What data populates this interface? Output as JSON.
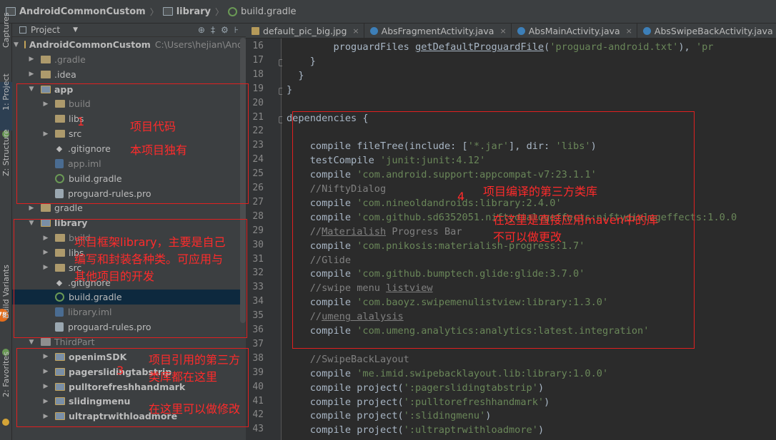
{
  "breadcrumb": [
    "AndroidCommonCustom",
    "library",
    "build.gradle"
  ],
  "tool_stripe": [
    "Captures",
    "1: Project",
    "Z: Structure",
    "Build Variants",
    "2: Favorites"
  ],
  "badge_text": "78",
  "project_panel": {
    "title": "Project",
    "tools": [
      "⊕",
      "‡",
      "⚙",
      "⊦"
    ],
    "rows": [
      {
        "indent": 0,
        "twisty": "▼",
        "icon": "module",
        "name": "AndroidCommonCustom",
        "path": "C:\\Users\\hejian\\Andr",
        "style": "bold"
      },
      {
        "indent": 1,
        "twisty": "▶",
        "icon": "folder",
        "name": ".gradle",
        "style": "dim"
      },
      {
        "indent": 1,
        "twisty": "▶",
        "icon": "folder",
        "name": ".idea",
        "style": ""
      },
      {
        "indent": 1,
        "twisty": "▼",
        "icon": "module",
        "name": "app",
        "style": "bold"
      },
      {
        "indent": 2,
        "twisty": "▶",
        "icon": "folder",
        "name": "build",
        "style": "dim"
      },
      {
        "indent": 2,
        "twisty": "",
        "icon": "folder",
        "name": "libs",
        "style": ""
      },
      {
        "indent": 2,
        "twisty": "▶",
        "icon": "folder",
        "name": "src",
        "style": ""
      },
      {
        "indent": 2,
        "twisty": "",
        "icon": "git",
        "name": ".gitignore",
        "style": ""
      },
      {
        "indent": 2,
        "twisty": "",
        "icon": "iml",
        "name": "app.iml",
        "style": "dim"
      },
      {
        "indent": 2,
        "twisty": "",
        "icon": "gradle",
        "name": "build.gradle",
        "style": ""
      },
      {
        "indent": 2,
        "twisty": "",
        "icon": "pro",
        "name": "proguard-rules.pro",
        "style": ""
      },
      {
        "indent": 1,
        "twisty": "▶",
        "icon": "folder",
        "name": "gradle",
        "style": ""
      },
      {
        "indent": 1,
        "twisty": "▼",
        "icon": "module",
        "name": "library",
        "style": "bold"
      },
      {
        "indent": 2,
        "twisty": "▶",
        "icon": "folder",
        "name": "build",
        "style": "dim"
      },
      {
        "indent": 2,
        "twisty": "▶",
        "icon": "folder",
        "name": "libs",
        "style": ""
      },
      {
        "indent": 2,
        "twisty": "▶",
        "icon": "folder",
        "name": "src",
        "style": ""
      },
      {
        "indent": 2,
        "twisty": "",
        "icon": "git",
        "name": ".gitignore",
        "style": ""
      },
      {
        "indent": 2,
        "twisty": "",
        "icon": "gradle",
        "name": "build.gradle",
        "style": "",
        "selected": true
      },
      {
        "indent": 2,
        "twisty": "",
        "icon": "iml",
        "name": "library.iml",
        "style": "dim"
      },
      {
        "indent": 2,
        "twisty": "",
        "icon": "pro",
        "name": "proguard-rules.pro",
        "style": ""
      },
      {
        "indent": 1,
        "twisty": "▼",
        "icon": "folder-gray",
        "name": "ThirdPart",
        "style": "dim"
      },
      {
        "indent": 2,
        "twisty": "▶",
        "icon": "module",
        "name": "openimSDK",
        "style": "bold"
      },
      {
        "indent": 2,
        "twisty": "▶",
        "icon": "module",
        "name": "pagerslidingtabstrip",
        "style": "bold"
      },
      {
        "indent": 2,
        "twisty": "▶",
        "icon": "module",
        "name": "pulltorefreshhandmark",
        "style": "bold"
      },
      {
        "indent": 2,
        "twisty": "▶",
        "icon": "module",
        "name": "slidingmenu",
        "style": "bold"
      },
      {
        "indent": 2,
        "twisty": "▶",
        "icon": "module",
        "name": "ultraptrwithloadmore",
        "style": "bold"
      }
    ]
  },
  "tabs": [
    {
      "label": "default_pic_big.jpg",
      "kind": "img"
    },
    {
      "label": "AbsFragmentActivity.java",
      "kind": "java"
    },
    {
      "label": "AbsMainActivity.java",
      "kind": "java"
    },
    {
      "label": "AbsSwipeBackActivity.java",
      "kind": "java"
    }
  ],
  "line_numbers": [
    "16",
    "17",
    "18",
    "19",
    "20",
    "21",
    "22",
    "23",
    "24",
    "25",
    "26",
    "27",
    "28",
    "29",
    "30",
    "31",
    "32",
    "33",
    "34",
    "35",
    "36",
    "37",
    "38",
    "39",
    "40",
    "41",
    "42",
    "43"
  ],
  "code_lines": [
    [
      [
        "        proguardFiles ",
        "kw"
      ],
      [
        "getDefaultProguardFile",
        "und"
      ],
      [
        "(",
        "kw"
      ],
      [
        "'proguard-android.txt'",
        "str"
      ],
      [
        "), ",
        "kw"
      ],
      [
        "'pr",
        "str"
      ]
    ],
    [
      [
        "    }",
        "kw"
      ]
    ],
    [
      [
        "  }",
        "kw"
      ]
    ],
    [
      [
        "}",
        "kw"
      ]
    ],
    [
      [
        "",
        "kw"
      ]
    ],
    [
      [
        "dependencies {",
        "kw"
      ]
    ],
    [
      [
        "",
        "kw"
      ]
    ],
    [
      [
        "    compile fileTree(include: [",
        "kw"
      ],
      [
        "'*.jar'",
        "str"
      ],
      [
        "], dir: ",
        "kw"
      ],
      [
        "'libs'",
        "str"
      ],
      [
        ")",
        "kw"
      ]
    ],
    [
      [
        "    testCompile ",
        "kw"
      ],
      [
        "'junit:junit:4.12'",
        "str"
      ]
    ],
    [
      [
        "    compile ",
        "kw"
      ],
      [
        "'com.android.support:appcompat-v7:23.1.1'",
        "str"
      ]
    ],
    [
      [
        "    //NiftyDialog",
        "cmt"
      ]
    ],
    [
      [
        "    compile ",
        "kw"
      ],
      [
        "'com.nineoldandroids:library:2.4.0'",
        "str"
      ]
    ],
    [
      [
        "    compile ",
        "kw"
      ],
      [
        "'com.github.sd6352051.niftydialogeffects:niftydialogeffects:1.0.0",
        "str"
      ]
    ],
    [
      [
        "    //",
        "cmt"
      ],
      [
        "Materialish",
        "cmt und"
      ],
      [
        " Progress Bar",
        "cmt"
      ]
    ],
    [
      [
        "    compile ",
        "kw"
      ],
      [
        "'com.pnikosis:materialish-progress:1.7'",
        "str"
      ]
    ],
    [
      [
        "    //Glide",
        "cmt"
      ]
    ],
    [
      [
        "    compile ",
        "kw"
      ],
      [
        "'com.github.bumptech.glide:glide:3.7.0'",
        "str"
      ]
    ],
    [
      [
        "    //swipe menu ",
        "cmt"
      ],
      [
        "listview",
        "cmt und"
      ]
    ],
    [
      [
        "    compile ",
        "kw"
      ],
      [
        "'com.baoyz.swipemenulistview:library:1.3.0'",
        "str"
      ]
    ],
    [
      [
        "    //",
        "cmt"
      ],
      [
        "umeng alalysis",
        "cmt und"
      ]
    ],
    [
      [
        "    compile ",
        "kw"
      ],
      [
        "'com.umeng.analytics:analytics:latest.integration'",
        "str"
      ]
    ],
    [
      [
        "",
        "kw"
      ]
    ],
    [
      [
        "    //SwipeBackLayout",
        "cmt"
      ]
    ],
    [
      [
        "    compile ",
        "kw"
      ],
      [
        "'me.imid.swipebacklayout.lib:library:1.0.0'",
        "str"
      ]
    ],
    [
      [
        "    compile project(",
        "kw"
      ],
      [
        "':pagerslidingtabstrip'",
        "str"
      ],
      [
        ")",
        "kw"
      ]
    ],
    [
      [
        "    compile project(",
        "kw"
      ],
      [
        "':pulltorefreshhandmark'",
        "str"
      ],
      [
        ")",
        "kw"
      ]
    ],
    [
      [
        "    compile project(",
        "kw"
      ],
      [
        "':slidingmenu'",
        "str"
      ],
      [
        ")",
        "kw"
      ]
    ],
    [
      [
        "    compile project(",
        "kw"
      ],
      [
        "':ultraptrwithloadmore'",
        "str"
      ],
      [
        ")",
        "kw"
      ]
    ]
  ],
  "annotations": {
    "n1": "1",
    "app_label1": "项目代码",
    "app_label2": "本项目独有",
    "lib_line1": "项目框架library，主要是自己",
    "lib_line2": "编写和封装各种类。可应用与",
    "lib_line3": "其他项目的开发",
    "n3": "3",
    "third_line1": "项目引用的第三方",
    "third_line2": "类库都在这里",
    "third_line3": "在这里可以做修改",
    "n4": "4",
    "dep_label1": "项目编译的第三方类库",
    "dep_label2": "在这里是直接应用maven中的库",
    "dep_label3": "不可以做更改"
  },
  "colors": {
    "annotation": "#ff2b2b",
    "string": "#6a8759",
    "comment": "#808080",
    "selection": "#0d293e"
  }
}
